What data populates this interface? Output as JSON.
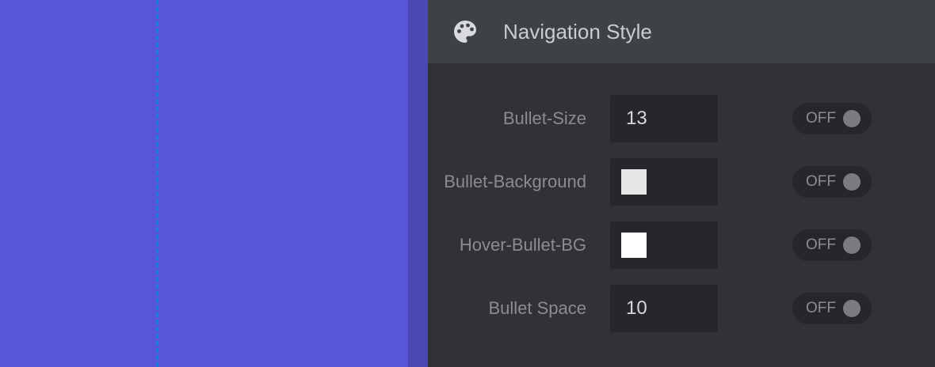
{
  "header": {
    "title": "Navigation Style",
    "icon": "palette-icon"
  },
  "rows": [
    {
      "label": "Bullet-Size",
      "value": "13",
      "toggle": "OFF"
    },
    {
      "label": "Bullet-Background",
      "swatch": "#e6e6e6",
      "toggle": "OFF"
    },
    {
      "label": "Hover-Bullet-BG",
      "swatch": "#ffffff",
      "toggle": "OFF"
    },
    {
      "label": "Bullet Space",
      "value": "10",
      "toggle": "OFF"
    }
  ],
  "colors": {
    "canvas": "#5856d6",
    "guide_line": "#1e7be0",
    "panel_bg": "#313235",
    "header_bg": "#3e4146"
  }
}
